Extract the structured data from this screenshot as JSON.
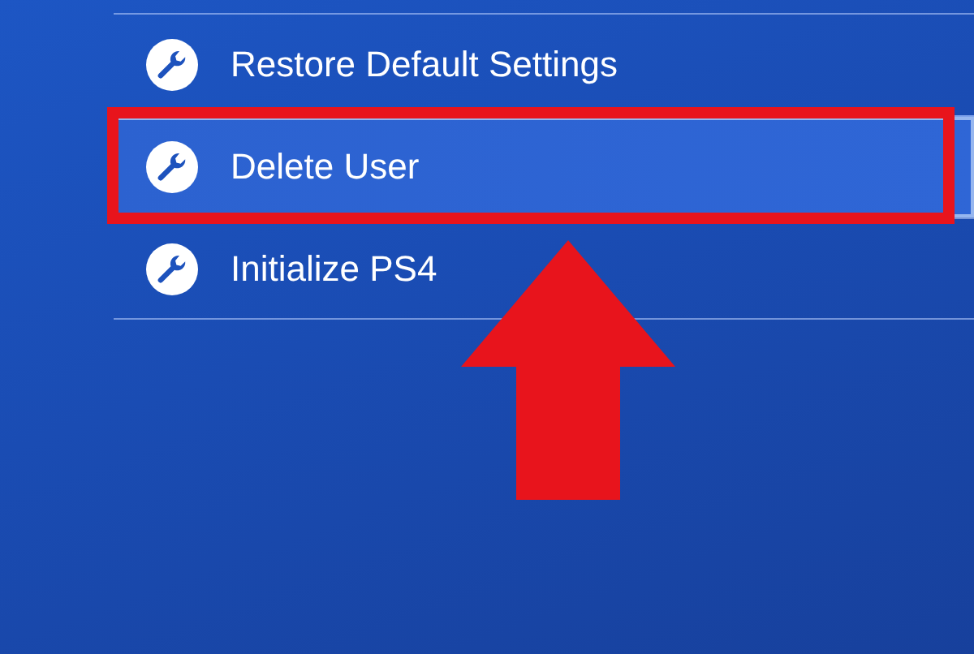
{
  "menu": {
    "items": [
      {
        "label": "Restore Default Settings",
        "selected": false
      },
      {
        "label": "Delete User",
        "selected": true
      },
      {
        "label": "Initialize PS4",
        "selected": false
      }
    ]
  }
}
